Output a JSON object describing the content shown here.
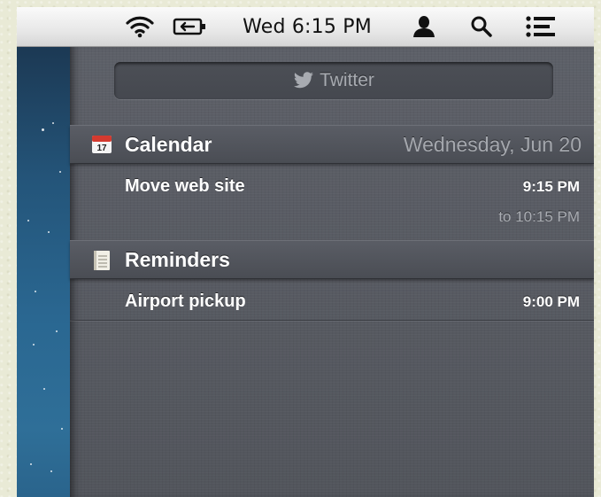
{
  "menubar": {
    "clock": "Wed 6:15 PM",
    "icons": [
      "wifi-icon",
      "battery-icon",
      "user-icon",
      "spotlight-search-icon",
      "notification-center-icon"
    ]
  },
  "notification_center": {
    "twitter_button": {
      "label": "Twitter",
      "icon": "twitter-bird-icon"
    },
    "sections": [
      {
        "title": "Calendar",
        "date": "Wednesday, Jun 20",
        "icon": "calendar-icon",
        "icon_text": "17",
        "items": [
          {
            "title": "Move web site",
            "time": "9:15 PM",
            "end": "to 10:15 PM"
          }
        ]
      },
      {
        "title": "Reminders",
        "icon": "reminders-icon",
        "items": [
          {
            "title": "Airport pickup",
            "time": "9:00 PM"
          }
        ]
      }
    ]
  },
  "colors": {
    "panel": "#54575e",
    "desktop_blue": "#2a6791",
    "header_date": "#a4a7ad",
    "menubar": "#f0f0f0"
  }
}
